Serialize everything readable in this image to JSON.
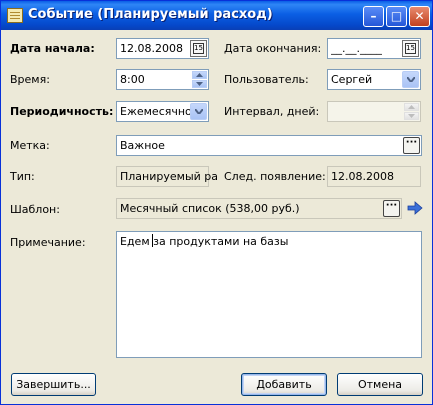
{
  "window": {
    "title": "Событие (Планируемый расход)",
    "buttons": {
      "minimize": "–",
      "maximize": "□",
      "close": "✕"
    }
  },
  "form": {
    "start_date": {
      "label": "Дата начала:",
      "value": "12.08.2008",
      "button": "15"
    },
    "end_date": {
      "label": "Дата окончания:",
      "value": "__.__.____",
      "button": "15"
    },
    "time": {
      "label": "Время:",
      "value": "8:00"
    },
    "user": {
      "label": "Пользователь:",
      "value": "Сергей"
    },
    "periodicity": {
      "label": "Периодичность:",
      "value": "Ежемесячно"
    },
    "interval": {
      "label": "Интервал, дней:",
      "value": ""
    },
    "tag": {
      "label": "Метка:",
      "value": "Важное",
      "button": "···"
    },
    "type": {
      "label": "Тип:",
      "value": "Планируемый ра"
    },
    "next_occurrence": {
      "label": "След. появление:",
      "value": "12.08.2008"
    },
    "template": {
      "label": "Шаблон:",
      "value": "Месячный список (538,00 руб.)",
      "button": "···"
    },
    "note": {
      "label": "Примечание:",
      "value": "Едем за продуктами на базы"
    }
  },
  "footer": {
    "finish_label": "Завершить...",
    "add_label": "Добавить",
    "cancel_label": "Отмена"
  },
  "colors": {
    "titlebar": "#0a5ee6",
    "window_bg": "#ece9d8",
    "field_border": "#7f9db9"
  }
}
